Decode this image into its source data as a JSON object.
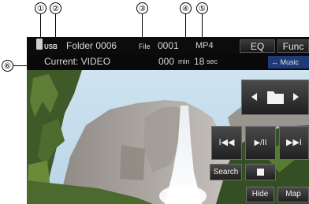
{
  "callouts": [
    "①",
    "②",
    "③",
    "④",
    "⑤",
    "⑥"
  ],
  "status_bar": {
    "source": "USB",
    "folder": "Folder 0006",
    "file_label": "File",
    "file_number": "0001",
    "format": "MP4",
    "eq_label": "EQ",
    "func_label": "Func"
  },
  "info_bar": {
    "current": "Current: VIDEO",
    "time_min": "000",
    "min_unit": "min",
    "time_sec": "18",
    "sec_unit": "sec",
    "music_tab": "↔ Music"
  },
  "controls": {
    "prev": "I◀◀",
    "play_pause": "▶/II",
    "next": "▶▶I",
    "search": "Search",
    "hide": "Hide",
    "map": "Map"
  }
}
